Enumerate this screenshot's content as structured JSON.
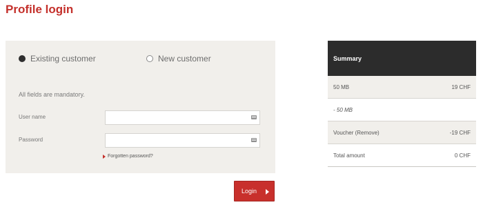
{
  "page": {
    "title": "Profile login"
  },
  "login": {
    "customer_options": [
      {
        "label": "Existing customer",
        "selected": true
      },
      {
        "label": "New customer",
        "selected": false
      }
    ],
    "mandatory_note": "All fields are mandatory.",
    "username_label": "User name",
    "username_value": "",
    "password_label": "Password",
    "password_value": "",
    "forgot_password_label": "Forgotten password?",
    "login_button_label": "Login",
    "icons": {
      "field_icon": "keyboard-icon",
      "link_icon": "red-arrow-icon",
      "button_icon": "chevron-right-icon"
    }
  },
  "summary": {
    "title": "Summary",
    "rows": [
      {
        "label": "50 MB",
        "value": "19 CHF"
      },
      {
        "label": "- 50 MB",
        "value": ""
      },
      {
        "label": "Voucher (Remove)",
        "value": "-19 CHF"
      },
      {
        "label": "Total amount",
        "value": "0 CHF"
      }
    ]
  },
  "colors": {
    "accent": "#c4302b",
    "panel_background": "#f1efeb",
    "summary_header": "#2c2c2c"
  }
}
